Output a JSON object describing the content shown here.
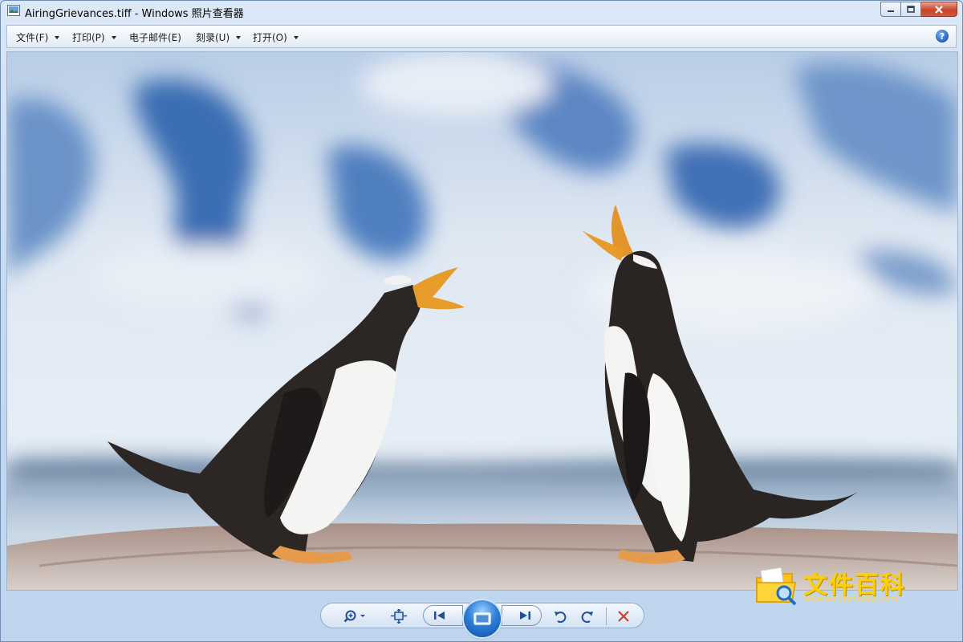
{
  "window": {
    "title": "AiringGrievances.tiff - Windows 照片查看器"
  },
  "menu": {
    "items": [
      {
        "label": "文件(F)",
        "has_arrow": true
      },
      {
        "label": "打印(P)",
        "has_arrow": true
      },
      {
        "label": "电子邮件(E)",
        "has_arrow": false
      },
      {
        "label": "刻录(U)",
        "has_arrow": true
      },
      {
        "label": "打开(O)",
        "has_arrow": true
      }
    ],
    "help_icon": "?"
  },
  "toolbar": {
    "icons": [
      "zoom-icon",
      "fit-to-window-icon",
      "previous-icon",
      "slideshow-icon",
      "next-icon",
      "rotate-counterclockwise-icon",
      "rotate-clockwise-icon",
      "delete-icon"
    ]
  },
  "watermark": {
    "name": "文件百科",
    "url": "www.wenjianbaike.com"
  },
  "colors": {
    "accent": "#2e7fd6",
    "delete": "#c9432c",
    "watermark": "#ffd000"
  }
}
